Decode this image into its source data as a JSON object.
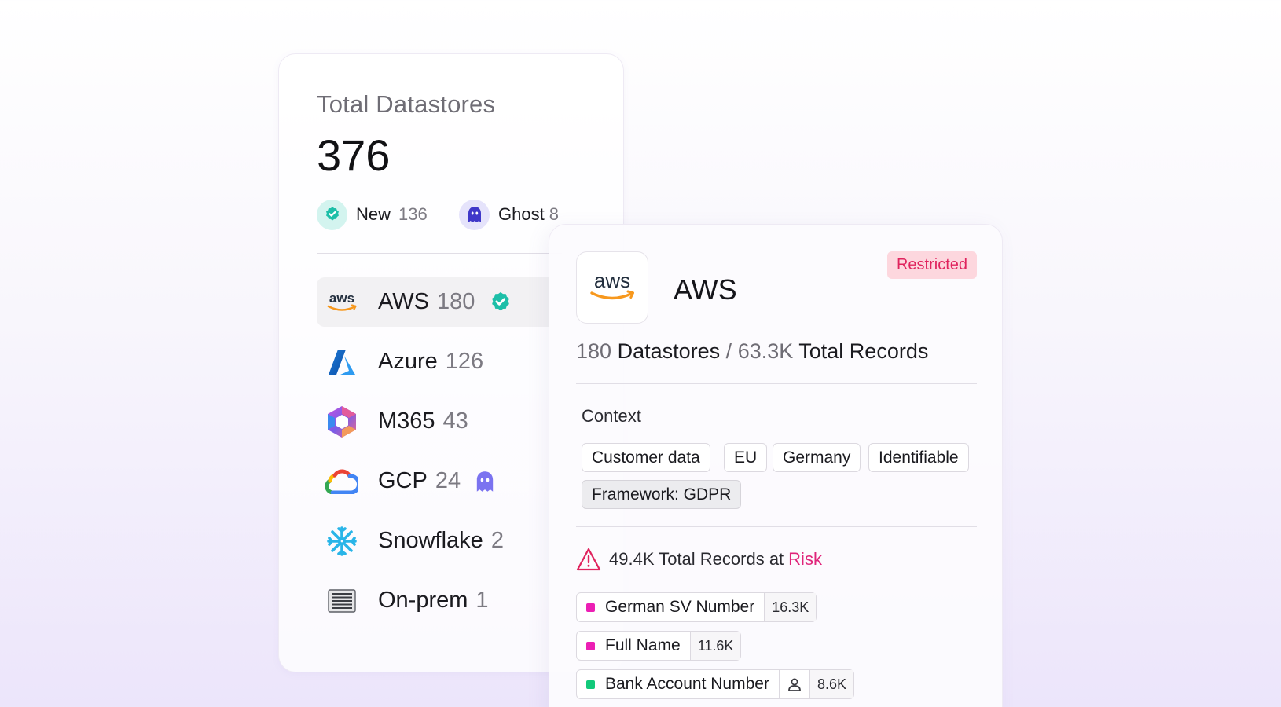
{
  "summary_card": {
    "title": "Total Datastores",
    "total": "376",
    "stats": {
      "new": {
        "label": "New",
        "count": "136",
        "icon": "verified-check-icon",
        "color": "#1dbfa8"
      },
      "ghost": {
        "label": "Ghost",
        "count": "8",
        "icon": "ghost-icon",
        "color": "#3f37c9"
      }
    },
    "providers": [
      {
        "name": "AWS",
        "count": "180",
        "icon": "aws-logo-icon",
        "badge": "verified-check-icon",
        "selected": true
      },
      {
        "name": "Azure",
        "count": "126",
        "icon": "azure-logo-icon"
      },
      {
        "name": "M365",
        "count": "43",
        "icon": "m365-logo-icon"
      },
      {
        "name": "GCP",
        "count": "24",
        "icon": "gcp-logo-icon",
        "badge": "ghost-icon"
      },
      {
        "name": "Snowflake",
        "count": "2",
        "icon": "snowflake-logo-icon"
      },
      {
        "name": "On-prem",
        "count": "1",
        "icon": "server-rack-icon"
      }
    ]
  },
  "detail_card": {
    "title": "AWS",
    "status": "Restricted",
    "datastores_count": "180",
    "datastores_label": "Datastores",
    "separator": "/",
    "records_count": "63.3K",
    "records_label": "Total Records",
    "context_label": "Context",
    "tags": [
      "Customer data",
      "EU",
      "Germany",
      "Identifiable",
      "Framework: GDPR"
    ],
    "risk": {
      "prefix": "49.4K Total Records at",
      "word": "Risk",
      "color": "#e0247a"
    },
    "records": [
      {
        "name": "German SV Number",
        "count": "16.3K",
        "color": "#ec1fb4"
      },
      {
        "name": "Full Name",
        "count": "11.6K",
        "color": "#ec1fb4"
      },
      {
        "name": "Bank Account Number",
        "count": "8.6K",
        "color": "#12c97a",
        "icon": "user-icon"
      }
    ]
  },
  "colors": {
    "accent_teal": "#1dbfa8",
    "restricted_bg": "#fdd7de",
    "restricted_text": "#e0245e"
  }
}
